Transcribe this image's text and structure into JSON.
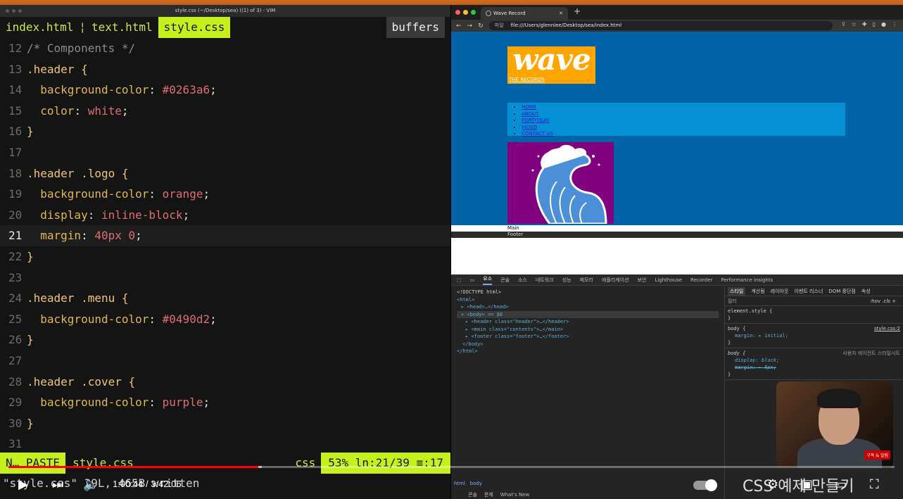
{
  "vim": {
    "window_title": "style.css (~/Desktop/sea) ((1) of 3) - VIM",
    "tabs": [
      {
        "label": "index.html",
        "active": false
      },
      {
        "label": "text.html",
        "active": false
      },
      {
        "label": "style.css",
        "active": true
      }
    ],
    "tab_separator": "¦",
    "buffers_label": "buffers",
    "lines": [
      {
        "n": "12",
        "parts": [
          [
            "c-com",
            "/* Components */"
          ]
        ]
      },
      {
        "n": "13",
        "parts": [
          [
            "c-sel",
            ".header {"
          ]
        ]
      },
      {
        "n": "14",
        "parts": [
          [
            "",
            "  "
          ],
          [
            "c-prop",
            "background-color"
          ],
          [
            "c-punct",
            ": "
          ],
          [
            "c-val",
            "#0263a6"
          ],
          [
            "c-punct",
            ";"
          ]
        ]
      },
      {
        "n": "15",
        "parts": [
          [
            "",
            "  "
          ],
          [
            "c-prop",
            "color"
          ],
          [
            "c-punct",
            ": "
          ],
          [
            "c-val",
            "white"
          ],
          [
            "c-punct",
            ";"
          ]
        ]
      },
      {
        "n": "16",
        "parts": [
          [
            "c-sel",
            "}"
          ]
        ]
      },
      {
        "n": "17",
        "parts": []
      },
      {
        "n": "18",
        "parts": [
          [
            "c-sel",
            ".header .logo {"
          ]
        ]
      },
      {
        "n": "19",
        "parts": [
          [
            "",
            "  "
          ],
          [
            "c-prop",
            "background-color"
          ],
          [
            "c-punct",
            ": "
          ],
          [
            "c-val",
            "orange"
          ],
          [
            "c-punct",
            ";"
          ]
        ]
      },
      {
        "n": "20",
        "parts": [
          [
            "",
            "  "
          ],
          [
            "c-prop",
            "display"
          ],
          [
            "c-punct",
            ": "
          ],
          [
            "c-val",
            "inline-block"
          ],
          [
            "c-punct",
            ";"
          ]
        ]
      },
      {
        "n": "21",
        "parts": [
          [
            "",
            "  "
          ],
          [
            "c-prop",
            "margin"
          ],
          [
            "c-punct",
            ": "
          ],
          [
            "c-num",
            "40px 0"
          ],
          [
            "c-punct",
            ";"
          ]
        ],
        "current": true
      },
      {
        "n": "22",
        "parts": [
          [
            "c-sel",
            "}"
          ]
        ]
      },
      {
        "n": "23",
        "parts": []
      },
      {
        "n": "24",
        "parts": [
          [
            "c-sel",
            ".header .menu {"
          ]
        ]
      },
      {
        "n": "25",
        "parts": [
          [
            "",
            "  "
          ],
          [
            "c-prop",
            "background-color"
          ],
          [
            "c-punct",
            ": "
          ],
          [
            "c-val",
            "#0490d2"
          ],
          [
            "c-punct",
            ";"
          ]
        ]
      },
      {
        "n": "26",
        "parts": [
          [
            "c-sel",
            "}"
          ]
        ]
      },
      {
        "n": "27",
        "parts": []
      },
      {
        "n": "28",
        "parts": [
          [
            "c-sel",
            ".header .cover {"
          ]
        ]
      },
      {
        "n": "29",
        "parts": [
          [
            "",
            "  "
          ],
          [
            "c-prop",
            "background-color"
          ],
          [
            "c-punct",
            ": "
          ],
          [
            "c-val",
            "purple"
          ],
          [
            "c-punct",
            ";"
          ]
        ]
      },
      {
        "n": "30",
        "parts": [
          [
            "c-sel",
            "}"
          ]
        ]
      },
      {
        "n": "31",
        "parts": []
      }
    ],
    "status": {
      "mode": "N… PASTE",
      "file": "style.css",
      "filetype": "css",
      "position": "53%  ln:21/39 ≡:17"
    },
    "cmdline": "\"style.css\" 39L, 465B written"
  },
  "browser": {
    "tab_title": "Wave Record",
    "new_tab": "+",
    "url_scheme": "파일",
    "url": "file:///Users/glenniee/Desktop/sea/index.html",
    "page": {
      "logo_word": "wave",
      "logo_sub": "THE RECORDS",
      "menu": [
        "HOME",
        "ABOUT",
        "PORTFOLIO",
        "VIDEO",
        "CONTACT US"
      ],
      "main_label": "Main",
      "footer_label": "Footer",
      "colors": {
        "header": "#0263a6",
        "logo": "orange",
        "menu": "#0490d2",
        "cover": "purple"
      }
    },
    "devtools": {
      "tabs": [
        "요소",
        "콘솔",
        "소스",
        "네트워크",
        "성능",
        "메모리",
        "애플리케이션",
        "보안",
        "Lighthouse",
        "Recorder",
        "Performance insights"
      ],
      "dom": [
        "<!DOCTYPE html>",
        "<html>",
        "<head>…</head>",
        "<body> == $0",
        "<header class=\"header\">…</header>",
        "<main class=\"contents\">…</main>",
        "<footer class=\"footer\">…</footer>",
        "</body>",
        "</html>"
      ],
      "style_tabs": [
        "스타일",
        "계산됨",
        "레이아웃",
        "이벤트 리스너",
        "DOM 중단점",
        "속성"
      ],
      "filter_placeholder": "필터",
      "filter_tools": ":hov  .cls  +",
      "rules": {
        "element_style": "element.style {",
        "body1_selector": "body {",
        "body1_source": "style.css:2",
        "body1_decl": "margin: ▸ initial;",
        "body2_selector": "body {",
        "body2_source": "사용자 에이전트 스타일시트",
        "body2_decl1": "display: block;",
        "body2_decl2": "margin: ▸ 8px;",
        "close": "}"
      },
      "breadcrumb": [
        "html",
        "body"
      ],
      "drawer": [
        "콘솔",
        "문제",
        "What's New"
      ]
    },
    "webcam_badge": "구독 & 알림"
  },
  "player": {
    "time": "1:00:44 / 3:42:06",
    "chapter": "CSS 예제 만들기",
    "played_fraction": 0.282,
    "buffered_fraction": 0.286
  }
}
